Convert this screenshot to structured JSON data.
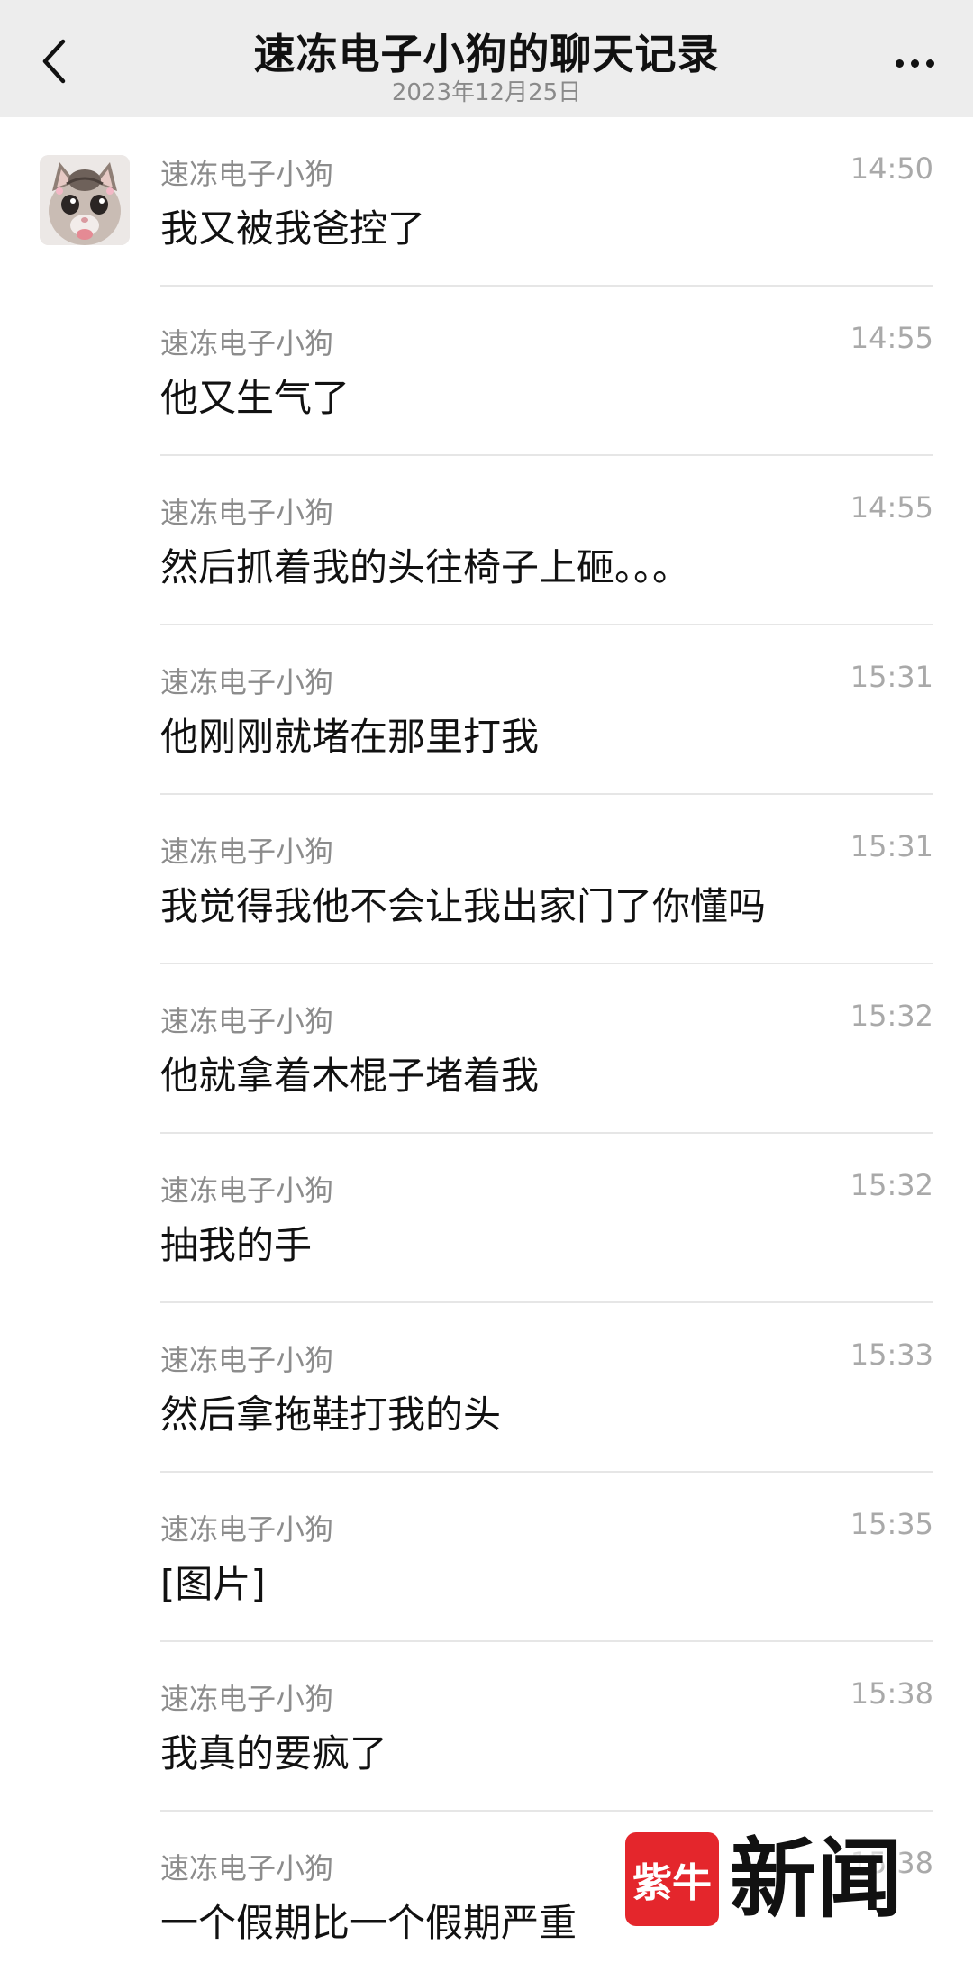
{
  "header": {
    "title": "速冻电子小狗的聊天记录",
    "date": "2023年12月25日"
  },
  "messages": [
    {
      "sender": "速冻电子小狗",
      "time": "14:50",
      "text": "我又被我爸控了"
    },
    {
      "sender": "速冻电子小狗",
      "time": "14:55",
      "text": "他又生气了"
    },
    {
      "sender": "速冻电子小狗",
      "time": "14:55",
      "text": "然后抓着我的头往椅子上砸。。。"
    },
    {
      "sender": "速冻电子小狗",
      "time": "15:31",
      "text": "他刚刚就堵在那里打我"
    },
    {
      "sender": "速冻电子小狗",
      "time": "15:31",
      "text": "我觉得我他不会让我出家门了你懂吗"
    },
    {
      "sender": "速冻电子小狗",
      "time": "15:32",
      "text": "他就拿着木棍子堵着我"
    },
    {
      "sender": "速冻电子小狗",
      "time": "15:32",
      "text": "抽我的手"
    },
    {
      "sender": "速冻电子小狗",
      "time": "15:33",
      "text": "然后拿拖鞋打我的头"
    },
    {
      "sender": "速冻电子小狗",
      "time": "15:35",
      "text": "[图片]"
    },
    {
      "sender": "速冻电子小狗",
      "time": "15:38",
      "text": "我真的要疯了"
    },
    {
      "sender": "速冻电子小狗",
      "time": "15:38",
      "text": "一个假期比一个假期严重"
    }
  ],
  "watermark": {
    "logo_text": "紫牛",
    "text": "新闻"
  },
  "icons": {
    "back": "chevron-left-icon",
    "more": "more-dots-icon",
    "avatar": "kitten-avatar"
  }
}
